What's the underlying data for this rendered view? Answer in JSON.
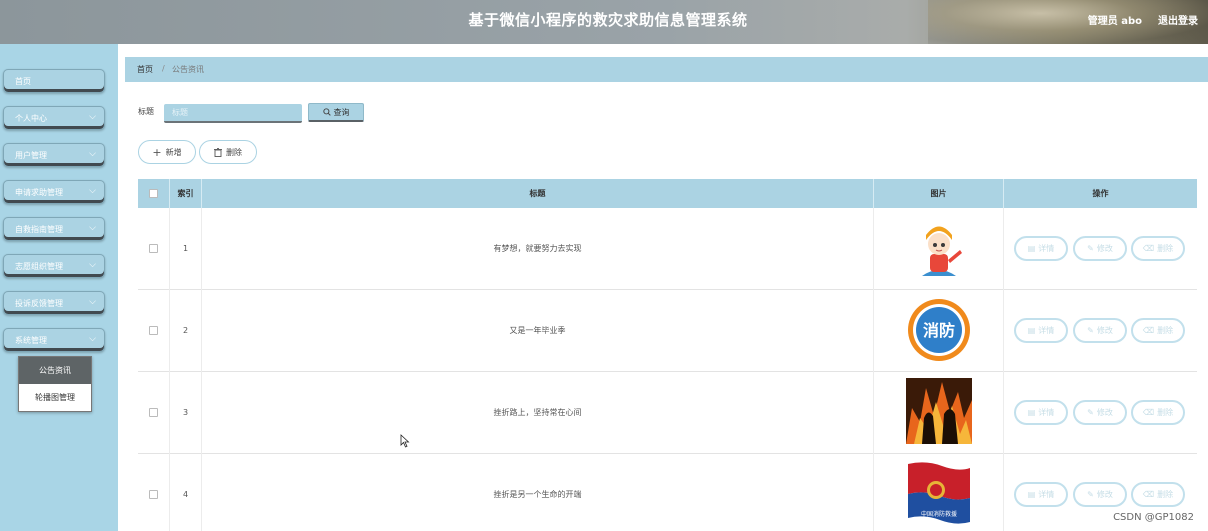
{
  "header": {
    "title": "基于微信小程序的救灾求助信息管理系统",
    "admin": "管理员 abo",
    "logout": "退出登录"
  },
  "sidebar": {
    "items": [
      {
        "label": "首页",
        "has_chevron": false
      },
      {
        "label": "个人中心",
        "has_chevron": true
      },
      {
        "label": "用户管理",
        "has_chevron": true
      },
      {
        "label": "申请求助管理",
        "has_chevron": true
      },
      {
        "label": "自救指南管理",
        "has_chevron": true
      },
      {
        "label": "志愿组织管理",
        "has_chevron": true
      },
      {
        "label": "投诉反馈管理",
        "has_chevron": true
      },
      {
        "label": "系统管理",
        "has_chevron": true
      }
    ],
    "submenu": [
      {
        "label": "公告资讯",
        "active": true
      },
      {
        "label": "轮播图管理",
        "active": false
      }
    ]
  },
  "breadcrumb": {
    "home": "首页",
    "separator": "/",
    "current": "公告资讯"
  },
  "search": {
    "label": "标题",
    "placeholder": "标题",
    "value": "",
    "button": "查询"
  },
  "toolbar": {
    "add": "新增",
    "delete": "删除"
  },
  "table": {
    "headers": {
      "index": "索引",
      "title": "标题",
      "image": "图片",
      "actions": "操作"
    },
    "rows": [
      {
        "index": "1",
        "title": "有梦想，就要努力去实现",
        "image": "cartoon-firefighter-image"
      },
      {
        "index": "2",
        "title": "又是一年毕业季",
        "image": "fire-protection-logo-image"
      },
      {
        "index": "3",
        "title": "挫折路上，坚持常在心间",
        "image": "firefighters-flames-image"
      },
      {
        "index": "4",
        "title": "挫折是另一个生命的开端",
        "image": "fire-rescue-flag-image"
      }
    ],
    "actions": {
      "detail": "详情",
      "edit": "修改",
      "delete": "删除"
    }
  },
  "images": {
    "logo_text": "消防",
    "flag_text": "中国消防救援"
  },
  "watermark": "CSDN @GP1082",
  "colors": {
    "accent": "#abd3e3",
    "sidebar": "#a9d5e6",
    "submenu_active": "#5e6466"
  }
}
